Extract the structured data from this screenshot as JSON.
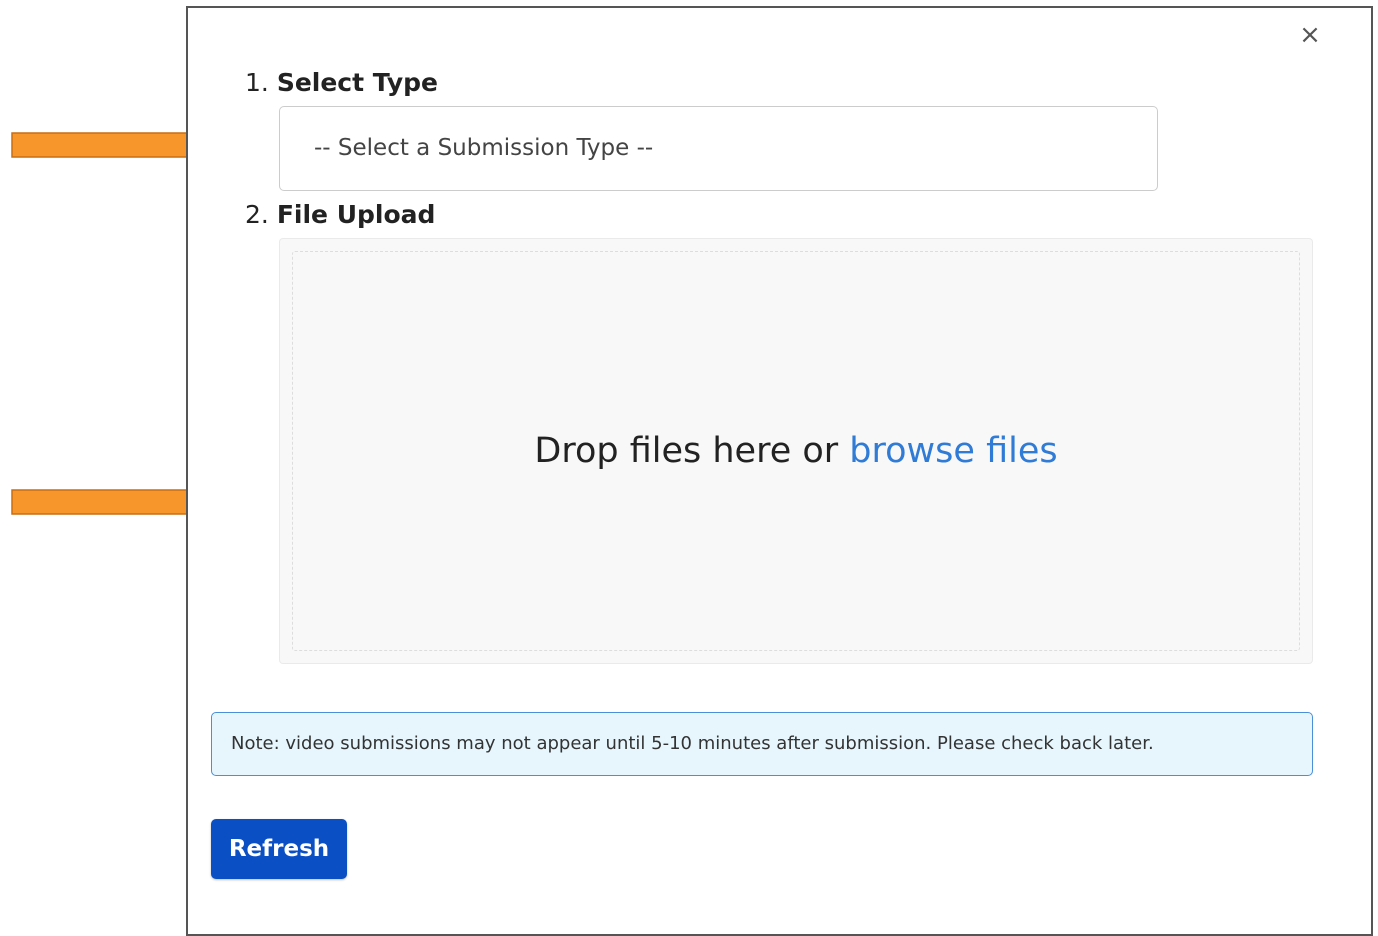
{
  "dialog": {
    "close_glyph": "×"
  },
  "step1": {
    "number": "1.",
    "title": "Select Type",
    "select_placeholder": "-- Select a Submission Type --"
  },
  "step2": {
    "number": "2.",
    "title": "File Upload",
    "drop_text": "Drop files here or ",
    "browse_link": "browse files"
  },
  "note": {
    "text": "Note: video submissions may not appear until 5-10 minutes after submission. Please check back later."
  },
  "actions": {
    "refresh_label": "Refresh"
  },
  "annotations": {
    "arrow_color": "#f7962a",
    "arrow_count": 2
  },
  "colors": {
    "primary_button": "#0a4fc4",
    "link": "#2f7bd6",
    "note_background": "#e7f6fd",
    "note_border": "#4a8fd8"
  }
}
